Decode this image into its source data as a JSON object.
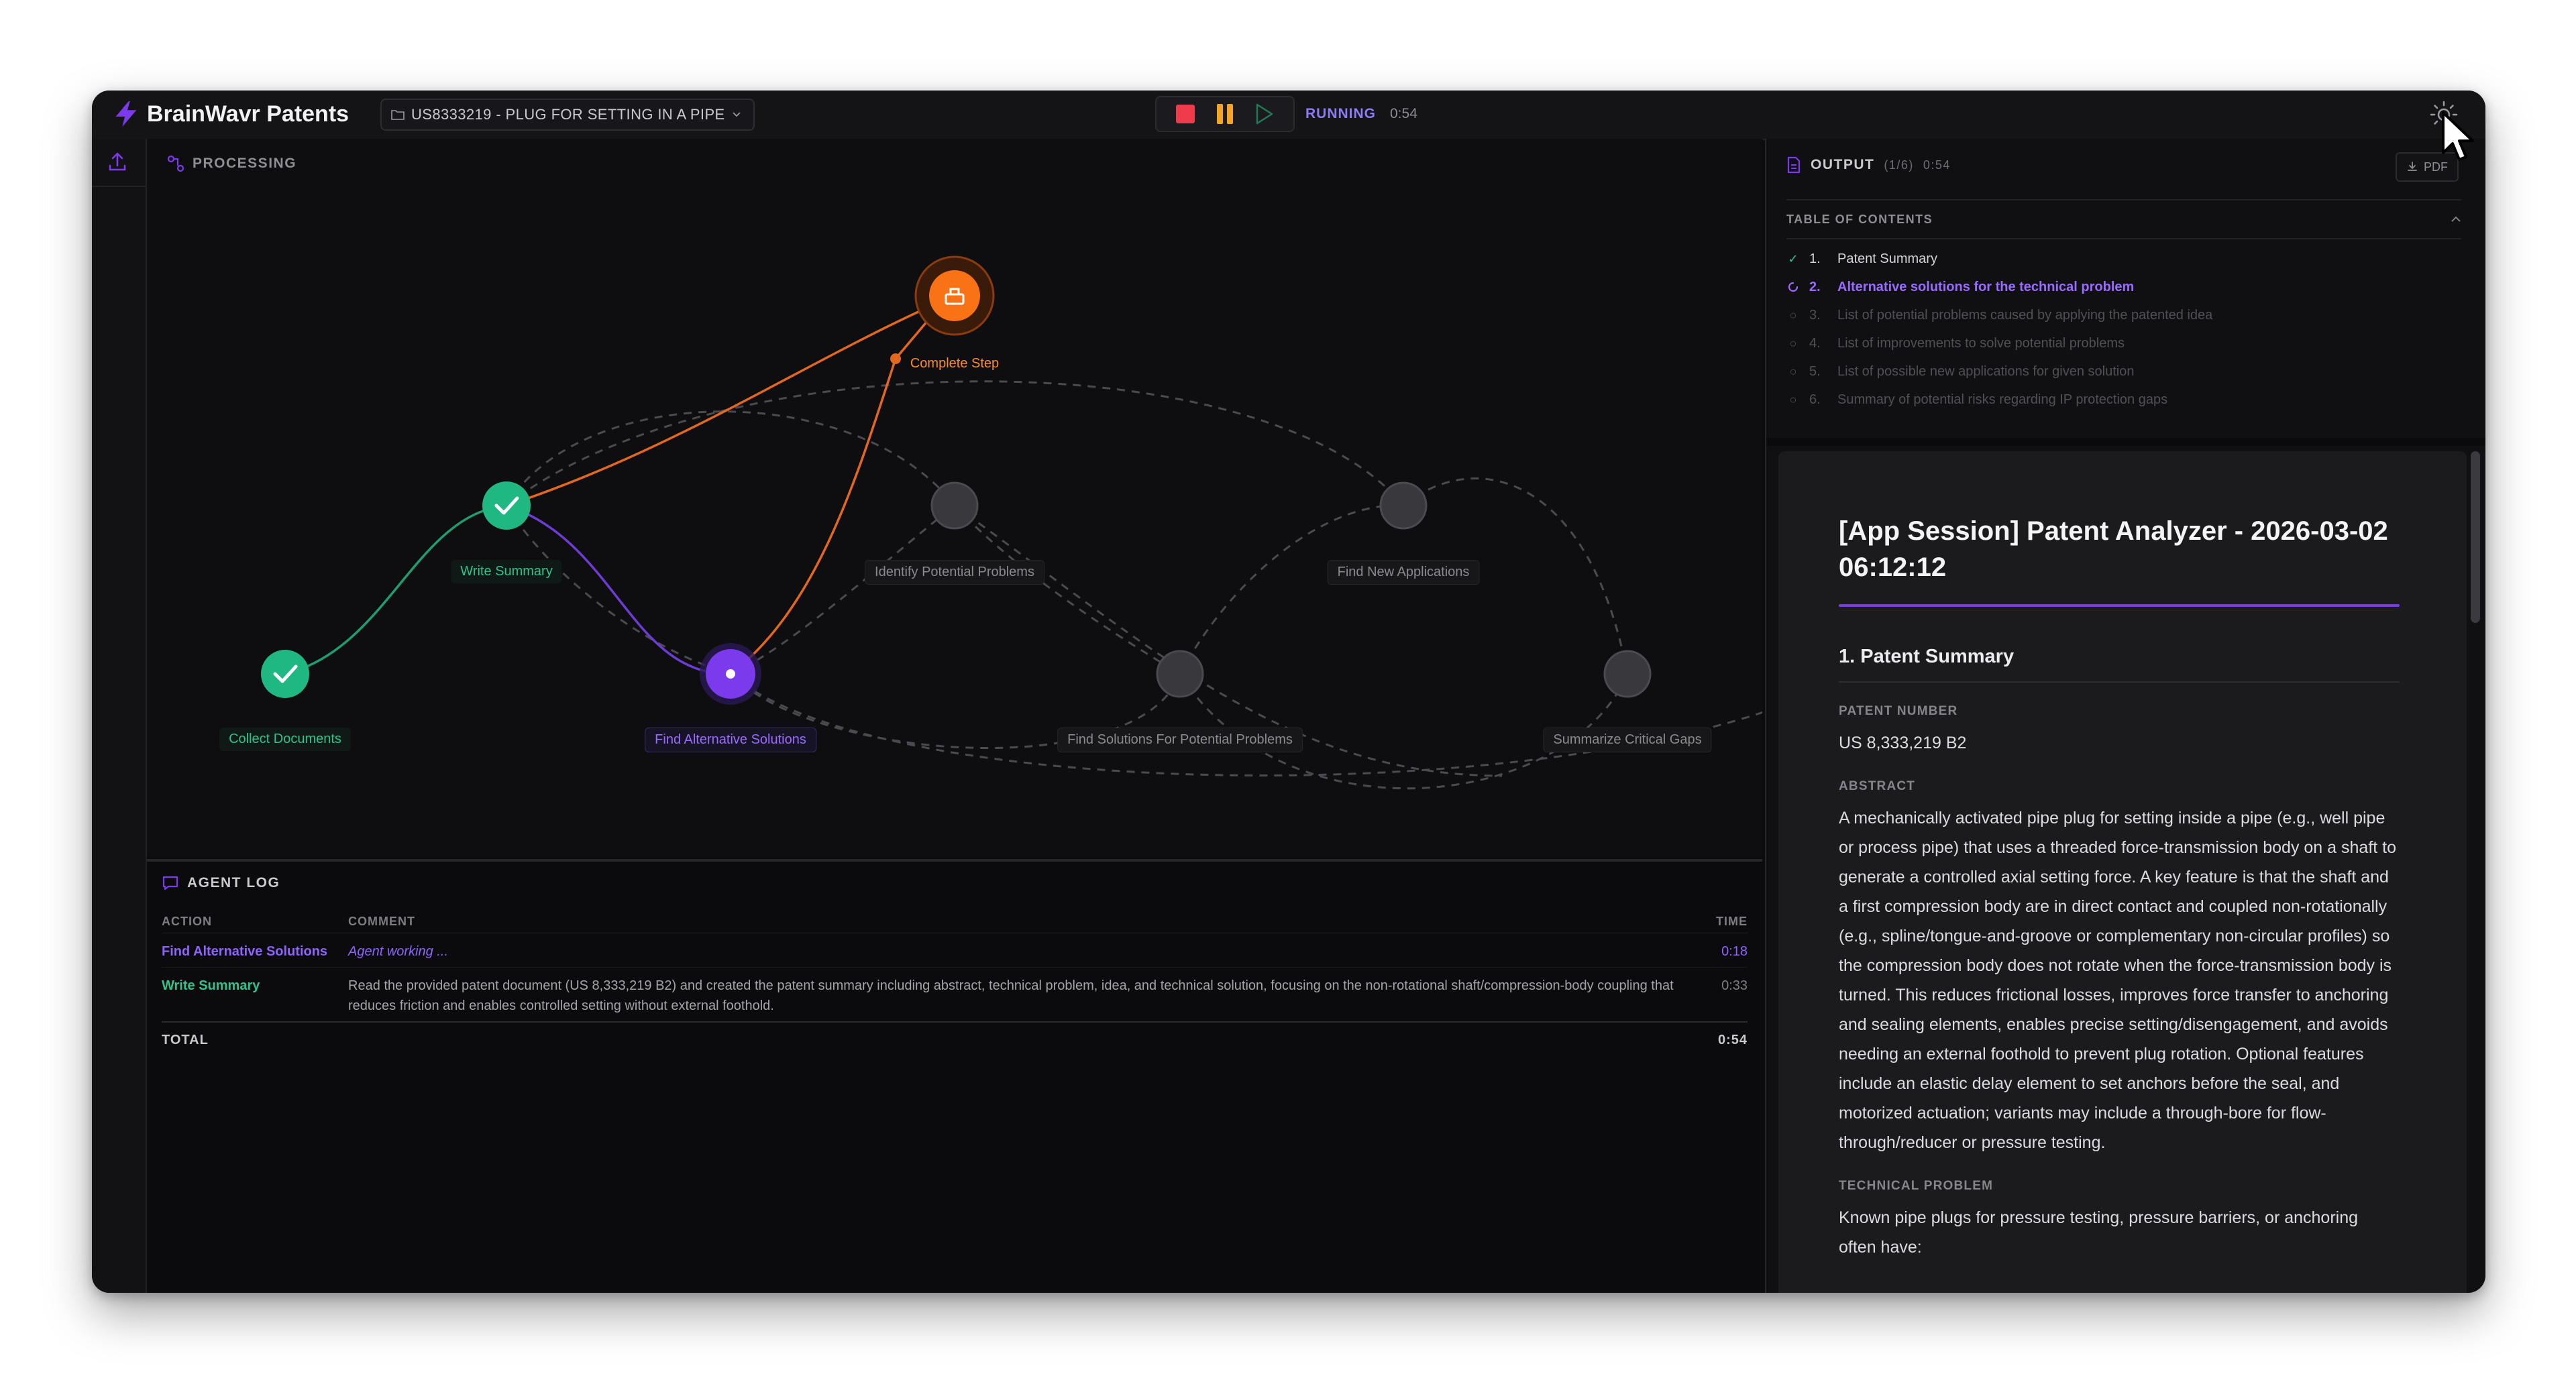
{
  "app": {
    "title": "BrainWavr Patents",
    "document_selector": "US8333219 - PLUG FOR SETTING IN A PIPE",
    "run_status": "RUNNING",
    "run_time": "0:54",
    "accent": "#8b5cf6"
  },
  "processing": {
    "heading": "PROCESSING",
    "nodes": {
      "complete_step": "Complete Step",
      "write_summary": "Write Summary",
      "collect_documents": "Collect Documents",
      "find_alternative_solutions": "Find Alternative Solutions",
      "identify_potential_problems": "Identify Potential Problems",
      "find_new_applications": "Find New Applications",
      "find_solutions_for_problems": "Find Solutions For Potential Problems",
      "summarize_critical_gaps": "Summarize Critical Gaps"
    },
    "status_colors": {
      "done": "#22c08a",
      "active": "#7c3aed",
      "final": "#f97316",
      "pending": "#3a3a3f"
    }
  },
  "agent_log": {
    "heading": "AGENT LOG",
    "columns": {
      "action": "ACTION",
      "comment": "COMMENT",
      "time": "TIME"
    },
    "rows": [
      {
        "action": "Find Alternative Solutions",
        "comment": "Agent working ...",
        "time": "0:18"
      },
      {
        "action": "Write Summary",
        "comment": "Read the provided patent document (US 8,333,219 B2) and created the patent summary including abstract, technical problem, idea, and technical solution, focusing on the non-rotational shaft/compression-body coupling that reduces friction and enables controlled setting without external foothold.",
        "time": "0:33"
      }
    ],
    "total_label": "TOTAL",
    "total_time": "0:54"
  },
  "output": {
    "heading": "OUTPUT",
    "count": "(1/6)",
    "time": "0:54",
    "pdf_label": "PDF",
    "toc_heading": "TABLE OF CONTENTS",
    "toc": [
      {
        "num": "1.",
        "label": "Patent Summary",
        "status": "done"
      },
      {
        "num": "2.",
        "label": "Alternative solutions for the technical problem",
        "status": "active"
      },
      {
        "num": "3.",
        "label": "List of potential problems caused by applying the patented idea",
        "status": "pending"
      },
      {
        "num": "4.",
        "label": "List of improvements to solve potential problems",
        "status": "pending"
      },
      {
        "num": "5.",
        "label": "List of possible new applications for given solution",
        "status": "pending"
      },
      {
        "num": "6.",
        "label": "Summary of potential risks regarding IP protection gaps",
        "status": "pending"
      }
    ],
    "document": {
      "title": "[App Session] Patent Analyzer - 2026-03-02 06:12:12",
      "section_title": "1.  Patent Summary",
      "patent_number_label": "PATENT NUMBER",
      "patent_number": "US 8,333,219 B2",
      "abstract_label": "ABSTRACT",
      "abstract": "A mechanically activated pipe plug for setting inside a pipe (e.g., well pipe or process pipe) that uses a threaded force-transmission body on a shaft to generate a controlled axial setting force. A key feature is that the shaft and a first compression body are in direct contact and coupled non-rotationally (e.g., spline/tongue-and-groove or complementary non-circular profiles) so the compression body does not rotate when the force-transmission body is turned. This reduces frictional losses, improves force transfer to anchoring and sealing elements, enables precise setting/disengagement, and avoids needing an external foothold to prevent plug rotation. Optional features include an elastic delay element to set anchors before the seal, and motorized actuation; variants may include a through-bore for flow-through/reducer or pressure testing.",
      "technical_problem_label": "TECHNICAL PROBLEM",
      "technical_problem": "Known pipe plugs for pressure testing, pressure barriers, or anchoring often have:"
    }
  }
}
